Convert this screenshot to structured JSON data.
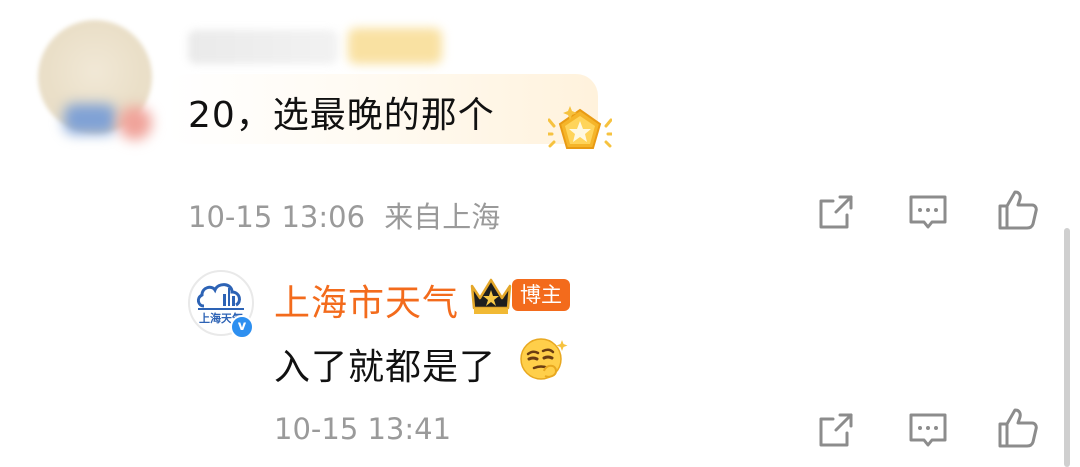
{
  "comment": {
    "text": "20，选最晚的那个",
    "time": "10-15 13:06",
    "location": "来自上海"
  },
  "reply": {
    "author": "上海市天气",
    "badge": "博主",
    "text": "入了就都是了",
    "time": "10-15 13:41",
    "avatar_text": "上海天气"
  },
  "icons": {
    "share": "share-icon",
    "comment": "comment-icon",
    "like": "like-icon"
  },
  "colors": {
    "author_orange": "#f36b1c",
    "meta_gray": "#9a9a9a",
    "verify_blue": "#2d8ff0"
  }
}
